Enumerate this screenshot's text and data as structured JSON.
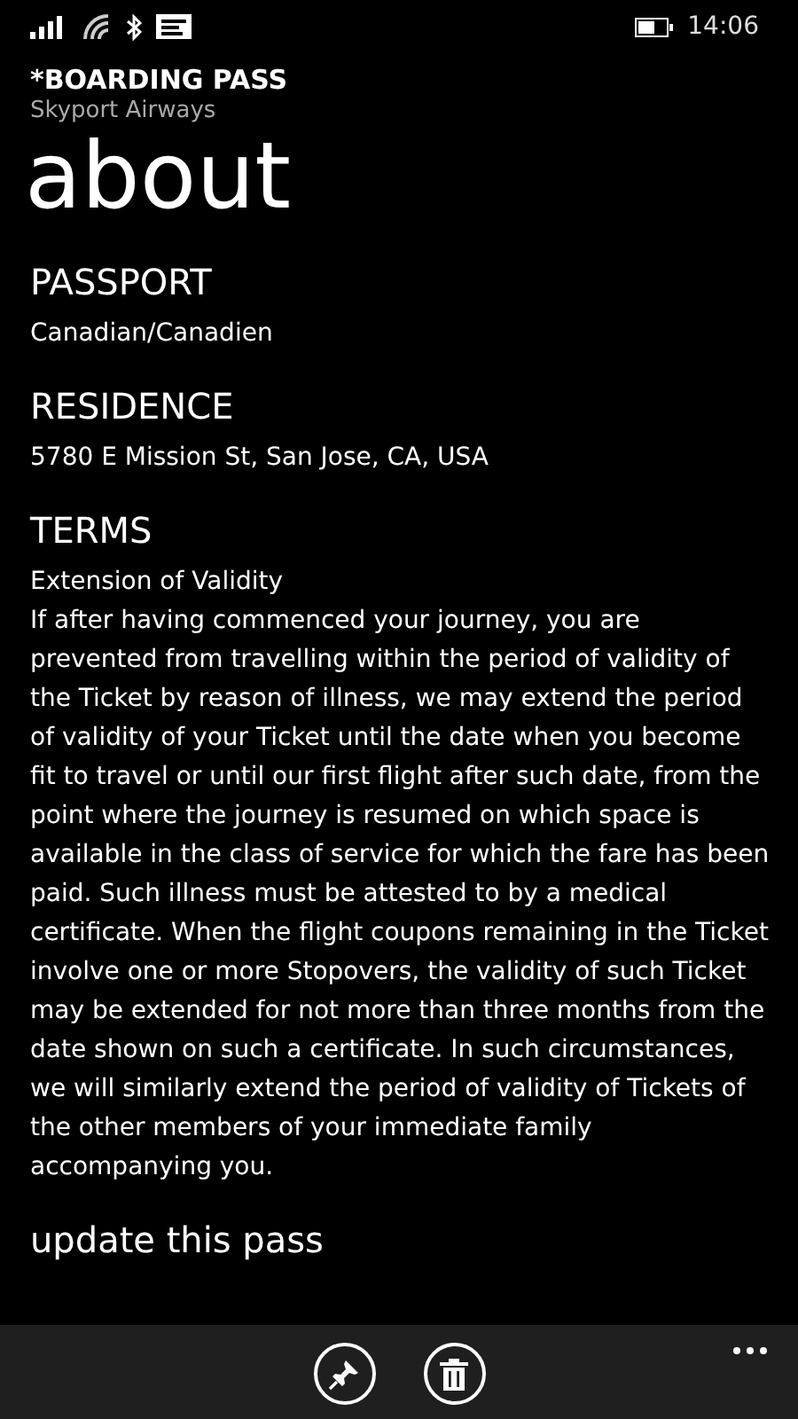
{
  "status_bar": {
    "time": "14:06"
  },
  "header": {
    "title": "*BOARDING PASS",
    "subtitle": "Skyport Airways"
  },
  "page_title": "about",
  "sections": [
    {
      "heading": "PASSPORT",
      "value": "Canadian/Canadien"
    },
    {
      "heading": "RESIDENCE",
      "value": "5780 E Mission St, San Jose, CA, USA"
    },
    {
      "heading": "TERMS",
      "subheading": "Extension of Validity",
      "value": "If after having commenced your journey, you are prevented from travelling within the period of validity of the Ticket by reason of illness, we may extend the period of validity of your Ticket until the date when you become fit to travel or until our first flight after such date, from the point where the journey is resumed on which space is available in the class of service for which the fare has been paid. Such illness must be attested to by a medical certificate. When the flight coupons remaining in the Ticket involve one or more Stopovers, the validity of such Ticket may be extended for not more than three months from the date shown on such a certificate. In such circumstances, we will similarly extend the period of validity of Tickets of the other members of your immediate family accompanying you."
    }
  ],
  "update_link": "update this pass",
  "app_bar": {
    "buttons": [
      {
        "kind": "pin"
      },
      {
        "kind": "delete"
      }
    ]
  }
}
